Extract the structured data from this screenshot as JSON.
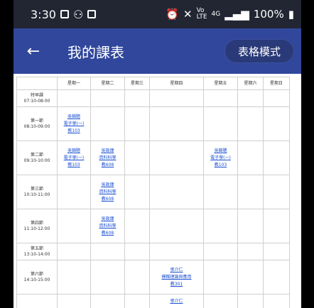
{
  "status": {
    "time": "3:30",
    "battery": "100%"
  },
  "appbar": {
    "title": "我的課表",
    "mode_button": "表格模式"
  },
  "columns": [
    "",
    "星期一",
    "星期二",
    "星期三",
    "星期四",
    "星期五",
    "星期六",
    "星期日"
  ],
  "rows": [
    {
      "name": "特早課",
      "time": "07:10-08:00",
      "cells": [
        [],
        [],
        [],
        [],
        [],
        [],
        []
      ]
    },
    {
      "name": "第一節",
      "time": "08:10-09:00",
      "cells": [
        [
          "吳錦聰",
          "電子學(一)",
          "教103"
        ],
        [],
        [],
        [],
        [],
        [],
        []
      ]
    },
    {
      "name": "第二節",
      "time": "09:10-10:00",
      "cells": [
        [
          "吳錦聰",
          "電子學(一)",
          "教103"
        ],
        [
          "吳政瑋",
          "資料科學",
          "教608"
        ],
        [],
        [],
        [
          "吳錦聰",
          "電子學(一)",
          "教103"
        ],
        [],
        []
      ]
    },
    {
      "name": "第三節",
      "time": "10:10-11:00",
      "cells": [
        [],
        [
          "吳政瑋",
          "資料科學",
          "教608"
        ],
        [],
        [],
        [],
        [],
        []
      ]
    },
    {
      "name": "第四節",
      "time": "11:10-12:00",
      "cells": [
        [],
        [
          "吳政瑋",
          "資料科學",
          "教608"
        ],
        [],
        [],
        [],
        [],
        []
      ]
    },
    {
      "name": "第五節",
      "time": "13:10-14:00",
      "cells": [
        [],
        [],
        [],
        [],
        [],
        [],
        []
      ]
    },
    {
      "name": "第六節",
      "time": "14:10-15:00",
      "cells": [
        [],
        [],
        [],
        [
          "張介仁",
          "模糊理論與應用",
          "教301"
        ],
        [],
        [],
        []
      ]
    },
    {
      "name": "",
      "time": "",
      "cells": [
        [],
        [],
        [],
        [
          "張介仁"
        ],
        [],
        [],
        []
      ]
    }
  ]
}
